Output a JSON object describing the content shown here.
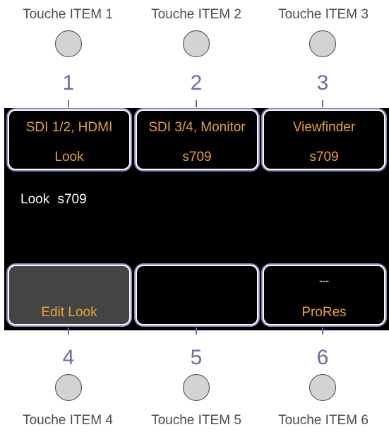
{
  "top_keys": [
    {
      "label": "Touche ITEM 1",
      "number": "1"
    },
    {
      "label": "Touche ITEM 2",
      "number": "2"
    },
    {
      "label": "Touche ITEM 3",
      "number": "3"
    }
  ],
  "bottom_keys": [
    {
      "label": "Touche ITEM 4",
      "number": "4"
    },
    {
      "label": "Touche ITEM 5",
      "number": "5"
    },
    {
      "label": "Touche ITEM 6",
      "number": "6"
    }
  ],
  "screen": {
    "top_tiles": [
      {
        "line1": "SDI 1/2, HDMI",
        "line2": "Look"
      },
      {
        "line1": "SDI 3/4, Monitor",
        "line2": "s709"
      },
      {
        "line1": "Viewfinder",
        "line2": "s709"
      }
    ],
    "status_text": "Look  s709",
    "bottom_tiles": [
      {
        "line1": "",
        "line2": "Edit Look"
      },
      {
        "line1": "",
        "line2": ""
      },
      {
        "line1": "---",
        "line2": "ProRes"
      }
    ]
  },
  "colors": {
    "tile_text": "#e8a23a",
    "number_color": "#6b6aa3",
    "tile_glow": "#8a86c4",
    "active_tile_bg": "#444444",
    "screen_bg": "#000000"
  }
}
